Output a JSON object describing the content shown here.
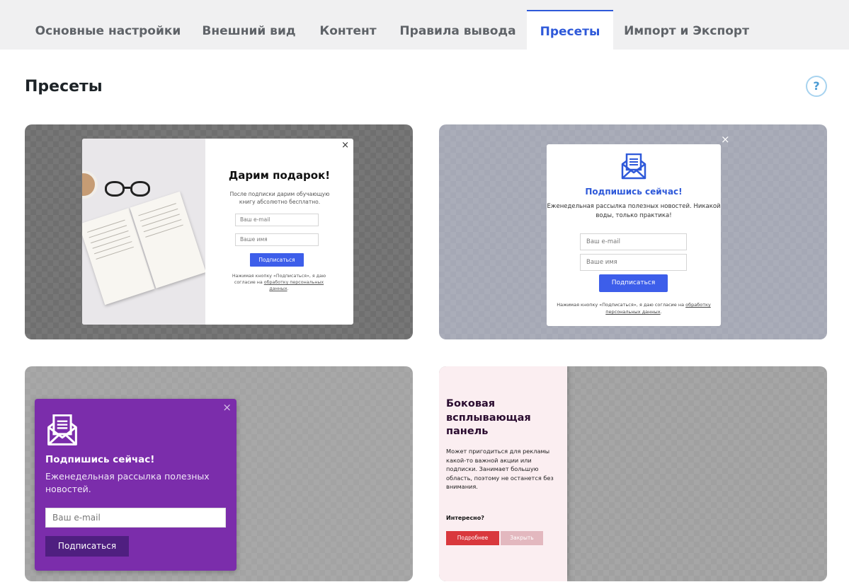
{
  "tabs": {
    "items": [
      {
        "label": "Основные настройки"
      },
      {
        "label": "Внешний вид"
      },
      {
        "label": "Контент"
      },
      {
        "label": "Правила вывода"
      },
      {
        "label": "Пресеты",
        "active": true
      },
      {
        "label": "Импорт и Экспорт"
      }
    ]
  },
  "header": {
    "title": "Пресеты",
    "help_label": "?"
  },
  "presets": {
    "p1": {
      "close": "×",
      "title": "Дарим подарок!",
      "desc": "После подписки дарим обучающую книгу абсолютно бесплатно.",
      "email_placeholder": "Ваш e-mail",
      "name_placeholder": "Ваше имя",
      "button": "Подписаться",
      "note_pre": "Нажимая кнопку «Подписаться», я даю согласие на ",
      "note_link": "обработку персональных данных",
      "note_post": "."
    },
    "p2": {
      "close": "×",
      "title": "Подпишись сейчас!",
      "desc": "Еженедельная рассылка полезных новостей. Никакой воды, только практика!",
      "email_placeholder": "Ваш e-mail",
      "name_placeholder": "Ваше имя",
      "button": "Подписаться",
      "note_pre": "Нажимая кнопку «Подписаться», я даю согласие на ",
      "note_link": "обработку персональных данных",
      "note_post": "."
    },
    "p3": {
      "close": "×",
      "title": "Подпишись сейчас!",
      "desc": "Еженедельная рассылка полезных новостей.",
      "email_placeholder": "Ваш e-mail",
      "button": "Подписаться"
    },
    "p4": {
      "title": "Боковая всплывающая панель",
      "desc": "Может пригодиться для рекламы какой-то важной акции или подписки. Занимает большую область, поэтому не останется без внимания.",
      "ask": "Интересно?",
      "more_button": "Подробнее",
      "close_button": "Закрыть"
    }
  },
  "colors": {
    "accent": "#2e59d9",
    "button_blue": "#3d5eea",
    "purple": "#7b2dab",
    "red": "#d9383d"
  }
}
